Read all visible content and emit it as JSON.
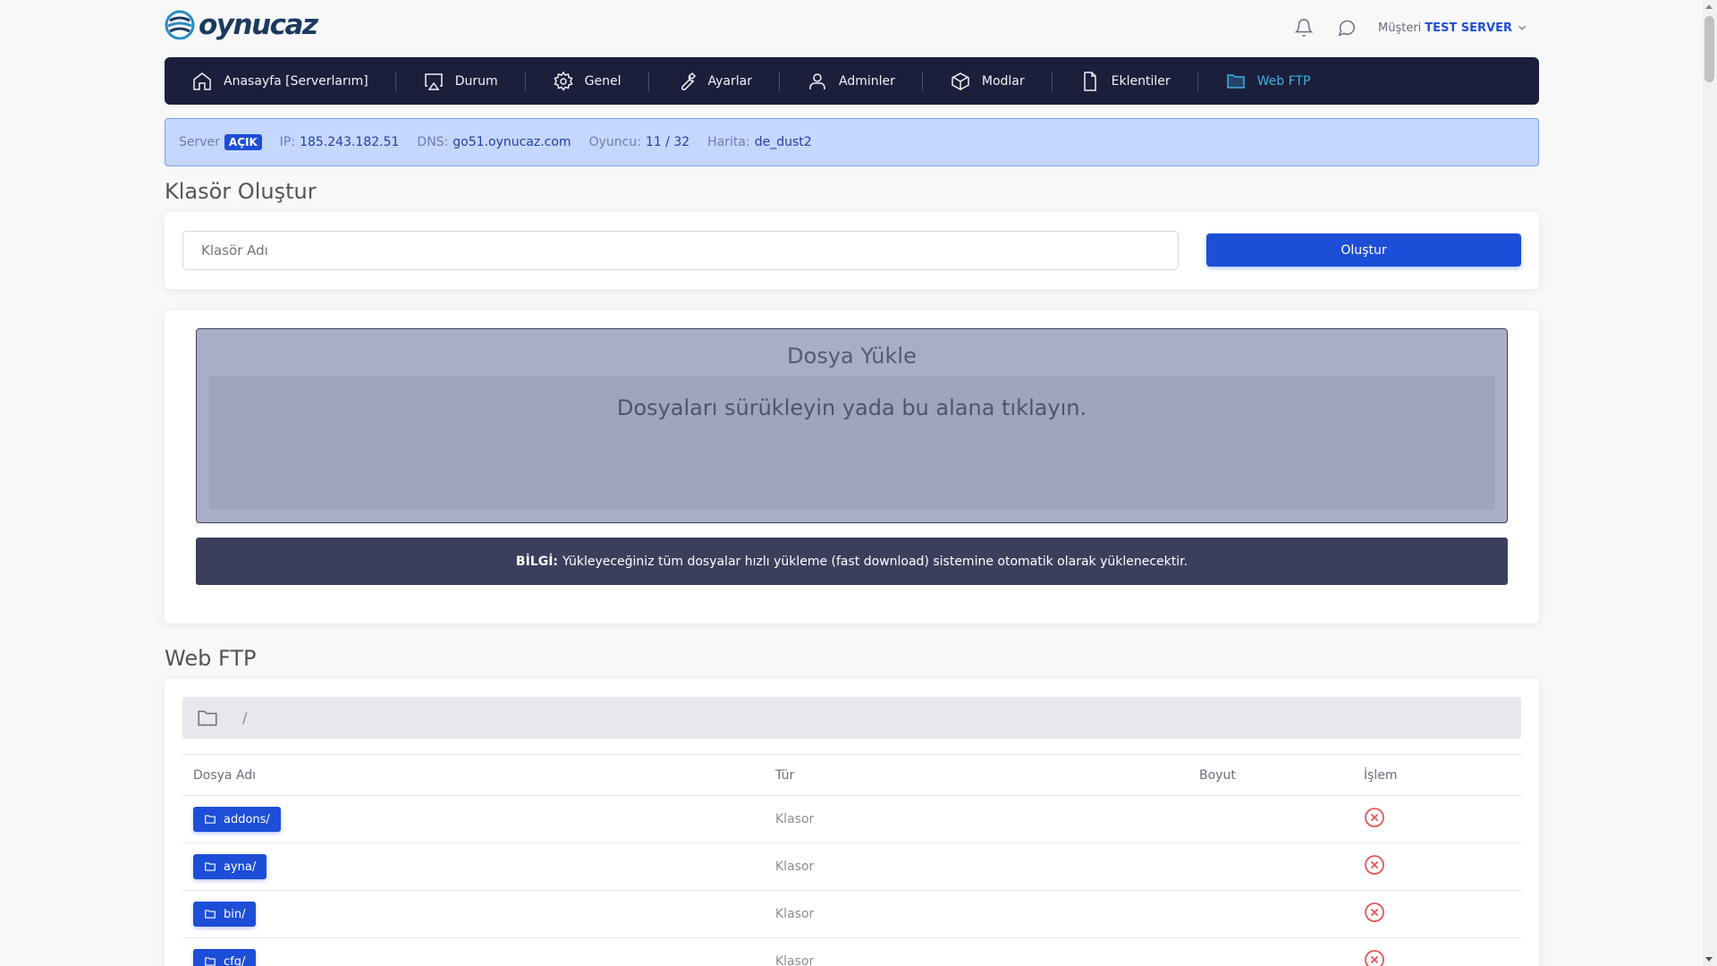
{
  "brand": {
    "logo_text": "oynucaz"
  },
  "header": {
    "customer_label": "Müşteri",
    "customer_name": "TEST SERVER"
  },
  "nav": [
    {
      "label": "Anasayfa [Serverlarım]",
      "icon": "home-icon"
    },
    {
      "label": "Durum",
      "icon": "monitor-icon"
    },
    {
      "label": "Genel",
      "icon": "gear-icon"
    },
    {
      "label": "Ayarlar",
      "icon": "wrench-icon"
    },
    {
      "label": "Adminler",
      "icon": "user-icon"
    },
    {
      "label": "Modlar",
      "icon": "box-icon"
    },
    {
      "label": "Eklentiler",
      "icon": "file-icon"
    },
    {
      "label": "Web FTP",
      "icon": "folder-icon",
      "active": true
    }
  ],
  "server_info": {
    "server_label": "Server",
    "status": "AÇIK",
    "ip_label": "IP:",
    "ip": "185.243.182.51",
    "dns_label": "DNS:",
    "dns": "go51.oynucaz.com",
    "players_label": "Oyuncu:",
    "players": "11 / 32",
    "map_label": "Harita:",
    "map": "de_dust2"
  },
  "create_folder": {
    "title": "Klasör Oluştur",
    "placeholder": "Klasör Adı",
    "button": "Oluştur"
  },
  "upload": {
    "title": "Dosya Yükle",
    "hint": "Dosyaları sürükleyin yada bu alana tıklayın.",
    "info_label": "BİLGİ:",
    "info_text": "Yükleyeceğiniz tüm dosyalar hızlı yükleme (fast download) sistemine otomatik olarak yüklenecektir."
  },
  "webftp": {
    "title": "Web FTP",
    "path": "/",
    "columns": {
      "name": "Dosya Adı",
      "type": "Tür",
      "size": "Boyut",
      "action": "İşlem"
    },
    "rows": [
      {
        "name": "addons/",
        "type": "Klasor",
        "size": ""
      },
      {
        "name": "ayna/",
        "type": "Klasor",
        "size": ""
      },
      {
        "name": "bin/",
        "type": "Klasor",
        "size": ""
      },
      {
        "name": "cfg/",
        "type": "Klasor",
        "size": ""
      }
    ]
  },
  "colors": {
    "primary": "#1d4ed8",
    "navbar": "#1b1f3b",
    "active_nav": "#3bb2e8",
    "info_bar": "#c5d7fd",
    "danger": "#ea5455"
  }
}
